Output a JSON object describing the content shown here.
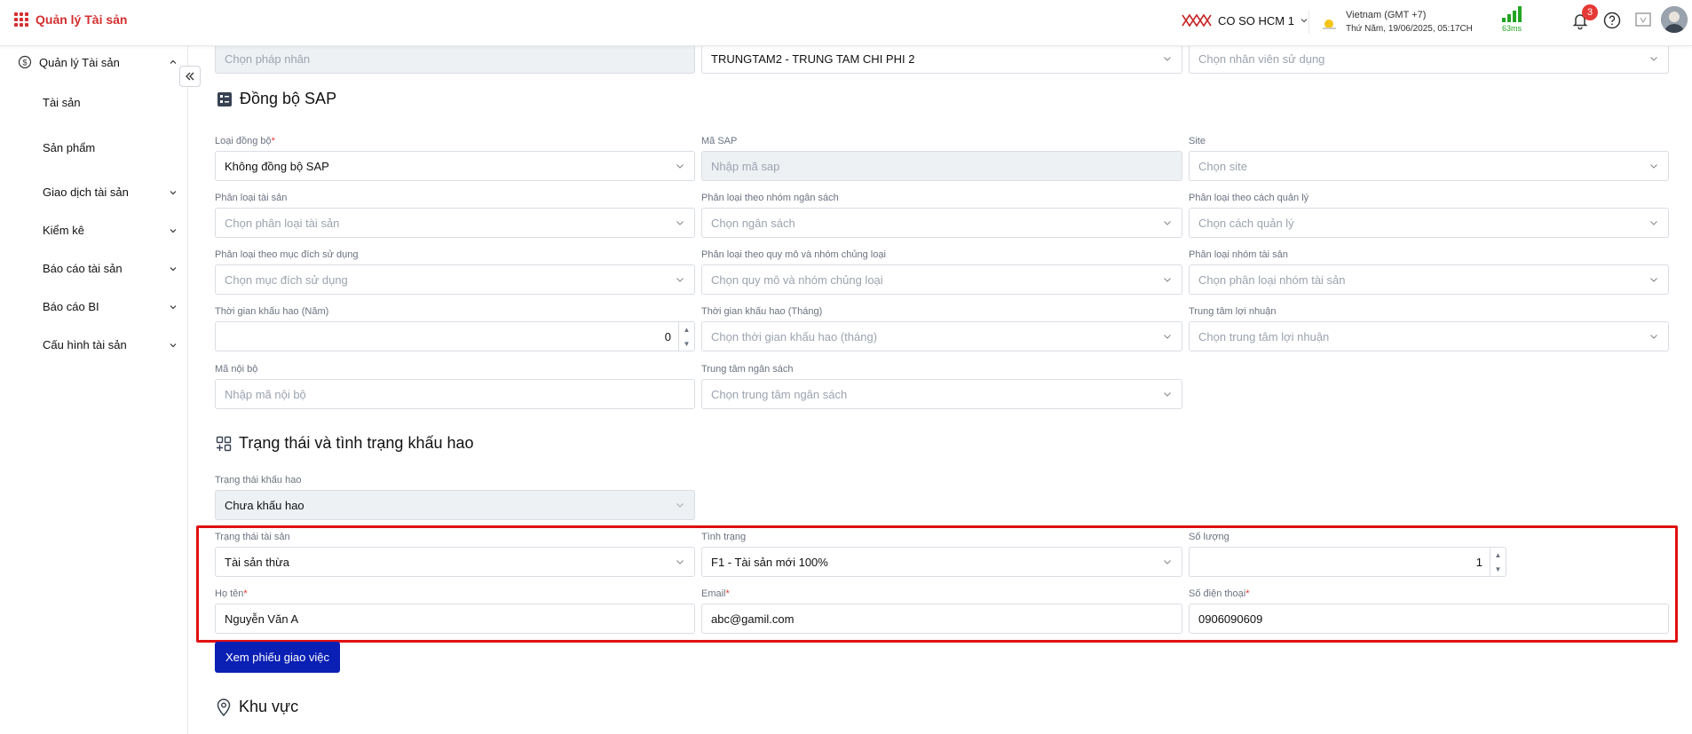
{
  "header": {
    "app_title": "Quản lý Tài sản",
    "org_name": "CO SO HCM 1",
    "timezone": "Vietnam (GMT +7)",
    "datetime": "Thứ Năm, 19/06/2025, 05:17CH",
    "ping": "63ms",
    "notification_count": "3"
  },
  "sidebar": {
    "group_label": "Quản lý Tài sản",
    "items": [
      {
        "label": "Tài sản",
        "expandable": false
      },
      {
        "label": "Sản phẩm",
        "expandable": false
      },
      {
        "label": "Giao dịch tài sản",
        "expandable": true
      },
      {
        "label": "Kiểm kê",
        "expandable": true
      },
      {
        "label": "Báo cáo tài sản",
        "expandable": true
      },
      {
        "label": "Báo cáo BI",
        "expandable": true
      },
      {
        "label": "Cấu hình tài sản",
        "expandable": true
      }
    ]
  },
  "top_row": {
    "legal_entity_placeholder": "Chọn pháp nhân",
    "cost_center_value": "TRUNGTAM2 - TRUNG TAM CHI PHI 2",
    "user_placeholder": "Chọn nhân viên sử dụng"
  },
  "sap": {
    "title": "Đồng bộ SAP",
    "sync_type_label": "Loại đồng bộ",
    "sync_type_value": "Không đồng bộ SAP",
    "sap_code_label": "Mã SAP",
    "sap_code_placeholder": "Nhập mã sap",
    "site_label": "Site",
    "site_placeholder": "Chọn site",
    "asset_class_label": "Phân loại tài sản",
    "asset_class_placeholder": "Chọn phân loại tài sản",
    "budget_group_label": "Phân loại theo nhóm ngân sách",
    "budget_group_placeholder": "Chọn ngân sách",
    "mgmt_label": "Phân loại theo cách quản lý",
    "mgmt_placeholder": "Chọn cách quản lý",
    "purpose_label": "Phân loại theo mục đích sử dụng",
    "purpose_placeholder": "Chọn mục đích sử dụng",
    "scale_label": "Phân loại theo quy mô và nhóm chủng loại",
    "scale_placeholder": "Chọn quy mô và nhóm chủng loại",
    "asset_group_label": "Phân loại nhóm tài sản",
    "asset_group_placeholder": "Chọn phân loại nhóm tài sản",
    "dep_years_label": "Thời gian khấu hao (Năm)",
    "dep_years_value": "0",
    "dep_months_label": "Thời gian khấu hao (Tháng)",
    "dep_months_placeholder": "Chọn thời gian khấu hao (tháng)",
    "profit_center_label": "Trung tâm lợi nhuận",
    "profit_center_placeholder": "Chọn trung tâm lợi nhuận",
    "internal_code_label": "Mã nội bộ",
    "internal_code_placeholder": "Nhập mã nội bộ",
    "budget_center_label": "Trung tâm ngân sách",
    "budget_center_placeholder": "Chọn trung tâm ngân sách"
  },
  "status": {
    "title": "Trạng thái và tình trạng khấu hao",
    "dep_status_label": "Trạng thái khấu hao",
    "dep_status_value": "Chưa khấu hao",
    "asset_status_label": "Trạng thái tài sản",
    "asset_status_value": "Tài sản thừa",
    "condition_label": "Tình trạng",
    "condition_value": "F1 - Tài sản mới 100%",
    "quantity_label": "Số lượng",
    "quantity_value": "1",
    "name_label": "Họ tên",
    "name_value": "Nguyễn Văn A",
    "email_label": "Email",
    "email_value": "abc@gamil.com",
    "phone_label": "Số điện thoại",
    "phone_value": "0906090609",
    "view_button": "Xem phiếu giao việc"
  },
  "area": {
    "title": "Khu vực"
  },
  "colors": {
    "brand_red": "#d32f2f",
    "primary_button": "#0a1fb4",
    "highlight_border": "#e01010",
    "signal_green": "#22a522"
  }
}
